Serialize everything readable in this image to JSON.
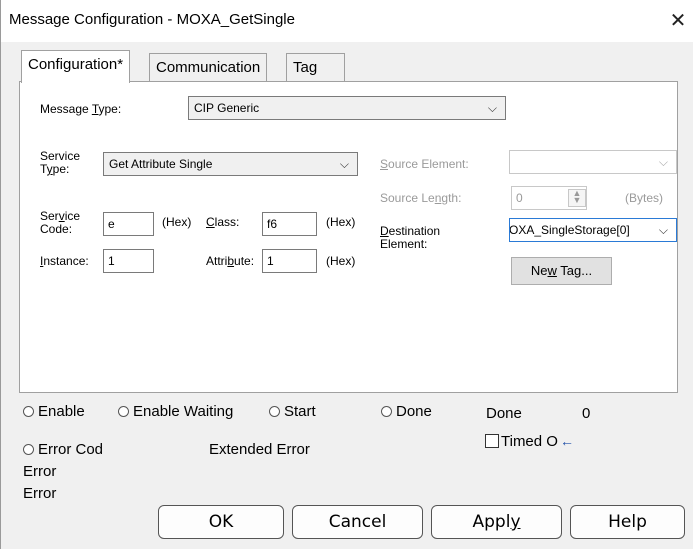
{
  "window": {
    "title": "Message Configuration - MOXA_GetSingle",
    "close_glyph": "✕"
  },
  "tabs": [
    {
      "label": "Configuration*",
      "active": true
    },
    {
      "label": "Communication",
      "active": false
    },
    {
      "label": "Tag",
      "active": false
    }
  ],
  "config": {
    "message_type_label_pre": "Message ",
    "message_type_label_acc": "T",
    "message_type_label_post": "ype:",
    "message_type_value": "CIP Generic",
    "service_type_label_1": "Service",
    "service_type_label_2_acc": "y",
    "service_type_label_2_pre": "T",
    "service_type_label_2_post": "pe:",
    "service_type_value": "Get Attribute Single",
    "service_code_label_1_pre": "Ser",
    "service_code_label_1_acc": "v",
    "service_code_label_1_post": "ice",
    "service_code_label_2": "Code:",
    "service_code_value": "e",
    "hex_label": "(Hex)",
    "class_label_acc": "C",
    "class_label_post": "lass:",
    "class_value": "f6",
    "instance_label_acc": "I",
    "instance_label_post": "nstance:",
    "instance_value": "1",
    "attribute_label_pre": "Attri",
    "attribute_label_acc": "b",
    "attribute_label_post": "ute:",
    "attribute_value": "1",
    "source_element_label_acc": "S",
    "source_element_label_post": "ource Element:",
    "source_element_value": "",
    "source_length_label_pre": "Source Le",
    "source_length_label_acc": "n",
    "source_length_label_post": "gth:",
    "source_length_value": "0",
    "bytes_label": "(Bytes)",
    "destination_label_acc": "D",
    "destination_label_post": "estination",
    "destination_label_2": "Element:",
    "destination_value": "OXA_SingleStorage[0]",
    "new_tag_pre": "Ne",
    "new_tag_acc": "w",
    "new_tag_post": " Tag..."
  },
  "status": {
    "enable": "Enable",
    "enable_waiting": "Enable Waiting",
    "start": "Start",
    "done": "Done",
    "done_label": "Done",
    "done_value": "0",
    "error_code": "Error Cod",
    "extended_error": "Extended Error",
    "timed_out": "Timed O",
    "error_line_1": "Error",
    "error_line_2": "Error"
  },
  "buttons": {
    "ok": "OK",
    "cancel": "Cancel",
    "apply_pre": "Appl",
    "apply_acc": "y",
    "help": "Help"
  },
  "icons": {
    "dropdown": "chevron-down-icon",
    "radio": "radio-icon",
    "checkbox": "checkbox-icon",
    "arrow": "arrow-left-icon"
  },
  "colors": {
    "focus_border": "#2a7ad6",
    "panel_bg": "#ffffff",
    "dialog_bg": "#f0f0f0"
  }
}
